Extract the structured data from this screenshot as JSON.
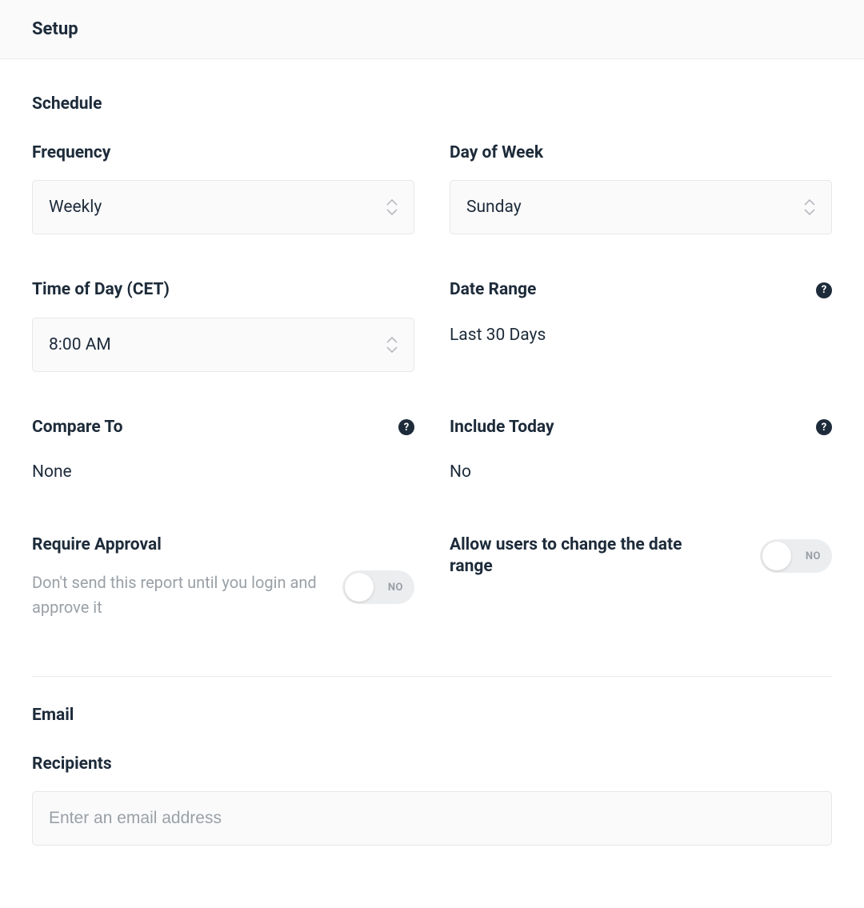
{
  "header": {
    "title": "Setup"
  },
  "schedule": {
    "heading": "Schedule",
    "frequency": {
      "label": "Frequency",
      "value": "Weekly"
    },
    "day_of_week": {
      "label": "Day of Week",
      "value": "Sunday"
    },
    "time_of_day": {
      "label": "Time of Day (CET)",
      "value": "8:00 AM"
    },
    "date_range": {
      "label": "Date Range",
      "value": "Last 30 Days"
    },
    "compare_to": {
      "label": "Compare To",
      "value": "None"
    },
    "include_today": {
      "label": "Include Today",
      "value": "No"
    },
    "require_approval": {
      "label": "Require Approval",
      "description": "Don't send this report until you login and approve it",
      "toggle_state": "NO"
    },
    "allow_change_date_range": {
      "label": "Allow users to change the date range",
      "toggle_state": "NO"
    }
  },
  "email": {
    "heading": "Email",
    "recipients": {
      "label": "Recipients",
      "placeholder": "Enter an email address"
    }
  }
}
